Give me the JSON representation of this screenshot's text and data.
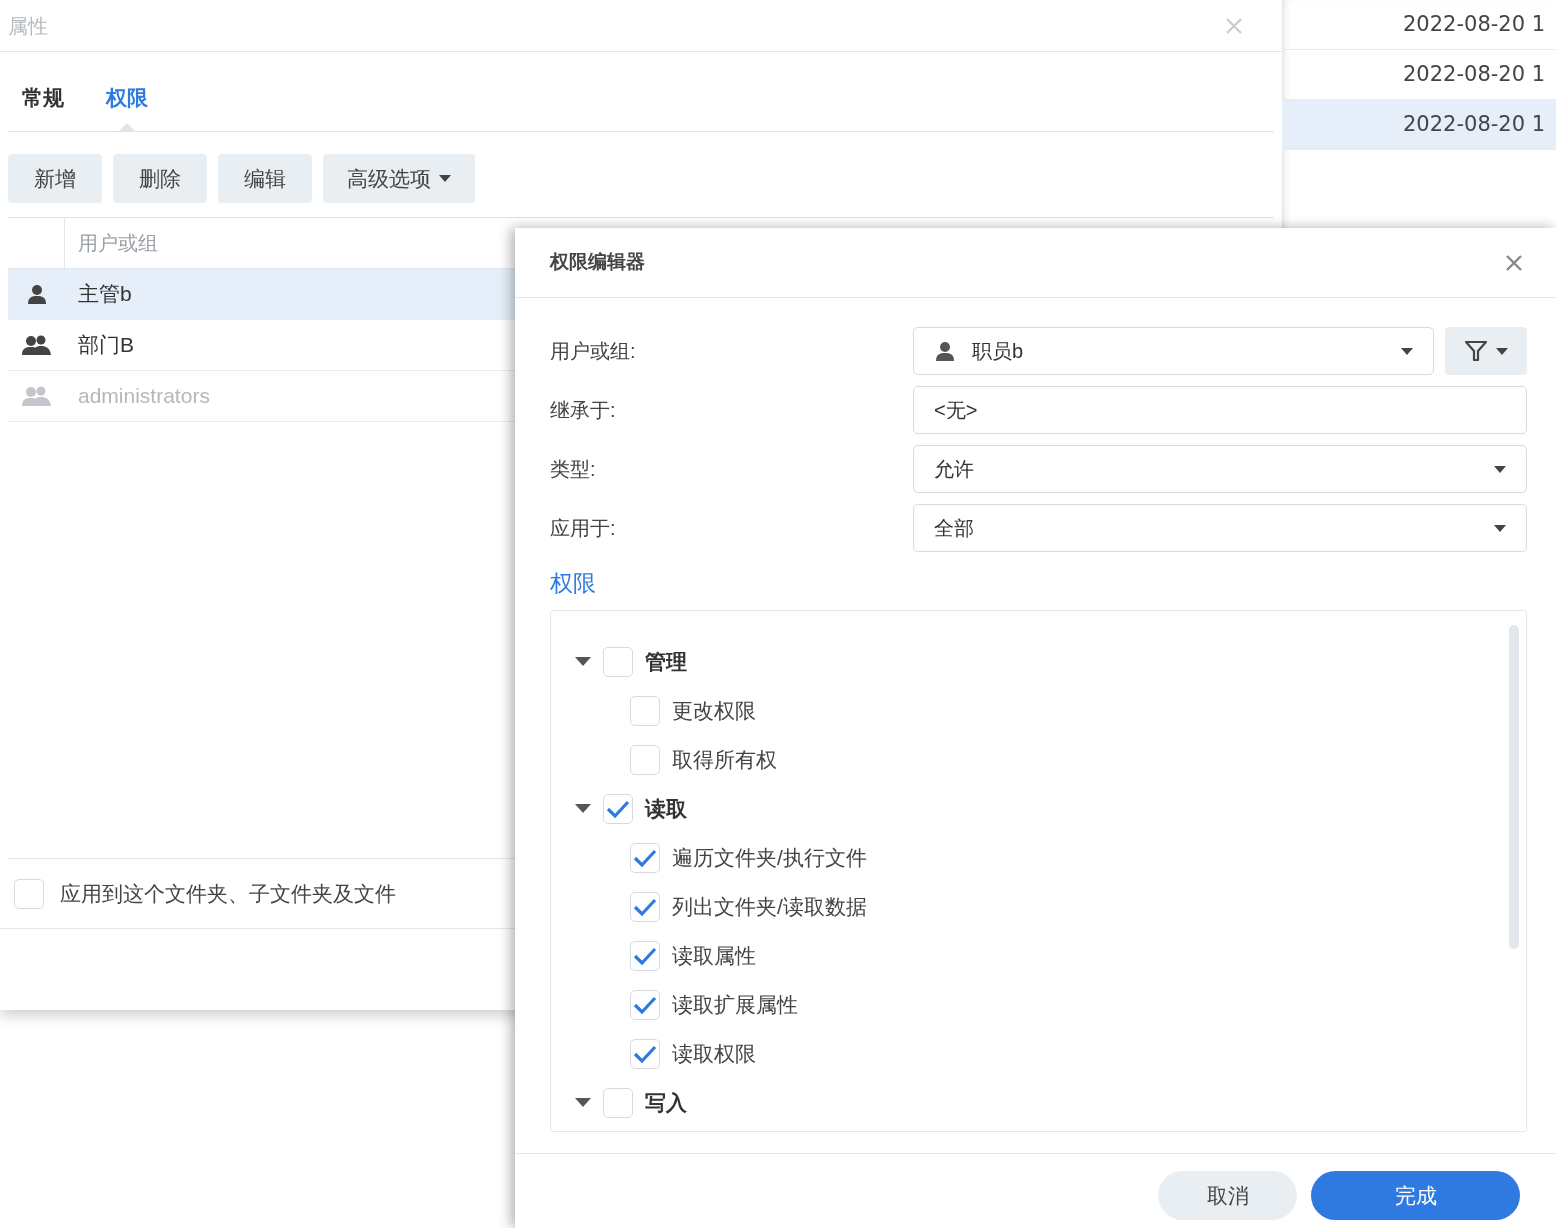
{
  "properties_dialog": {
    "title": "属性",
    "tabs": [
      {
        "label": "常规",
        "selected": false
      },
      {
        "label": "权限",
        "selected": true
      }
    ],
    "toolbar": [
      {
        "label": "新增",
        "dropdown": false
      },
      {
        "label": "删除",
        "dropdown": false
      },
      {
        "label": "编辑",
        "dropdown": false
      },
      {
        "label": "高级选项",
        "dropdown": true
      }
    ],
    "table": {
      "columns": [
        "用户或组"
      ],
      "rows": [
        {
          "kind": "user",
          "name": "主管b",
          "selected": true,
          "disabled": false
        },
        {
          "kind": "group",
          "name": "部门B",
          "selected": false,
          "disabled": false
        },
        {
          "kind": "group",
          "name": "administrators",
          "selected": false,
          "disabled": true
        }
      ]
    },
    "apply_option": {
      "label": "应用到这个文件夹、子文件夹及文件",
      "checked": false
    }
  },
  "file_list": {
    "rows": [
      {
        "modified": "2022-08-20 1",
        "selected": false
      },
      {
        "modified": "2022-08-20 1",
        "selected": false
      },
      {
        "modified": "2022-08-20 1",
        "selected": true
      }
    ]
  },
  "permission_editor": {
    "title": "权限编辑器",
    "fields": [
      {
        "kind": "user-select",
        "label": "用户或组:",
        "value": "职员b"
      },
      {
        "kind": "text",
        "label": "继承于:",
        "value": "<无>"
      },
      {
        "kind": "select",
        "label": "类型:",
        "value": "允许"
      },
      {
        "kind": "select",
        "label": "应用于:",
        "value": "全部"
      }
    ],
    "section_title": "权限",
    "permissions": [
      {
        "label": "管理",
        "checked": false,
        "expanded": true,
        "children": [
          {
            "label": "更改权限",
            "checked": false
          },
          {
            "label": "取得所有权",
            "checked": false
          }
        ]
      },
      {
        "label": "读取",
        "checked": true,
        "expanded": true,
        "children": [
          {
            "label": "遍历文件夹/执行文件",
            "checked": true
          },
          {
            "label": "列出文件夹/读取数据",
            "checked": true
          },
          {
            "label": "读取属性",
            "checked": true
          },
          {
            "label": "读取扩展属性",
            "checked": true
          },
          {
            "label": "读取权限",
            "checked": true
          }
        ]
      },
      {
        "label": "写入",
        "checked": false,
        "expanded": true
      }
    ],
    "buttons": [
      {
        "kind": "secondary",
        "label": "取消"
      },
      {
        "kind": "primary",
        "label": "完成"
      }
    ]
  }
}
